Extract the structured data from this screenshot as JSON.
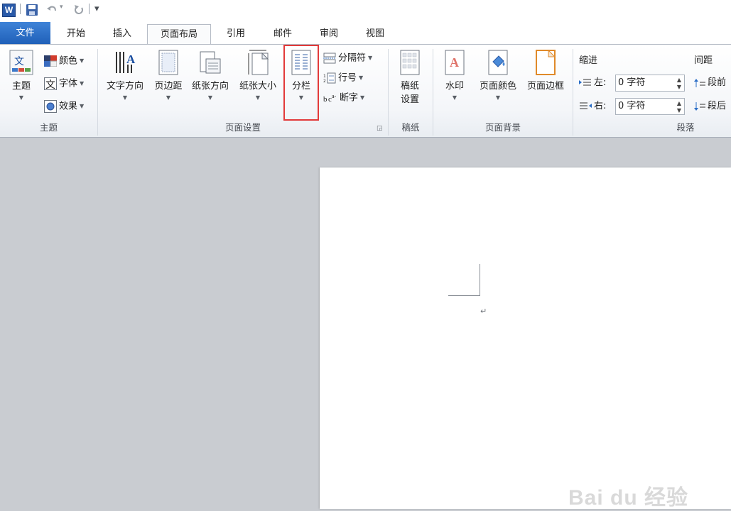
{
  "qat": {
    "logo": "W",
    "customize": "▾"
  },
  "tabs": [
    "文件",
    "开始",
    "插入",
    "页面布局",
    "引用",
    "邮件",
    "审阅",
    "视图"
  ],
  "groups": {
    "theme": {
      "label": "主题",
      "themes_button": "主题",
      "colors": "颜色",
      "fonts": "字体",
      "effects": "效果"
    },
    "page_setup": {
      "label": "页面设置",
      "text_direction": "文字方向",
      "margins": "页边距",
      "orientation": "纸张方向",
      "size": "纸张大小",
      "columns": "分栏",
      "breaks": "分隔符",
      "line_numbers": "行号",
      "hyphenation": "断字"
    },
    "manuscript": {
      "label": "稿纸",
      "button_line1": "稿纸",
      "button_line2": "设置"
    },
    "page_background": {
      "label": "页面背景",
      "watermark": "水印",
      "page_color": "页面颜色",
      "page_borders": "页面边框"
    },
    "paragraph": {
      "label": "段落",
      "indent_title": "缩进",
      "spacing_title": "间距",
      "left_label": "左:",
      "right_label": "右:",
      "left_value": "0 字符",
      "right_value": "0 字符",
      "before_label": "段前",
      "after_label": "段后"
    }
  },
  "document": {
    "paragraph_mark": "↵"
  },
  "watermark_text": "Bai du 经验"
}
